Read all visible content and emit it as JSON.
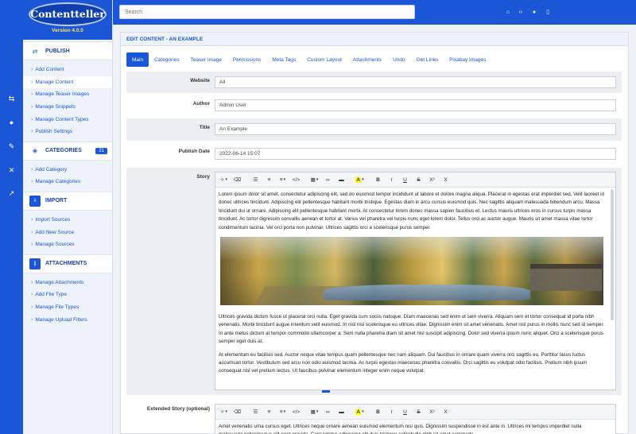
{
  "brand": {
    "logo_text": "Contentteller",
    "version": "Version 4.0.0"
  },
  "rail_icons": [
    "publish-icon",
    "user-icon",
    "edit-icon",
    "tools-icon",
    "external-link-icon"
  ],
  "sidebar": {
    "publish": {
      "title": "PUBLISH",
      "items": [
        "Add Content",
        "Manage Content",
        "Manage Teaser Images",
        "Manage Snippets",
        "Manage Content Types",
        "Publish Settings"
      ]
    },
    "categories": {
      "title": "CATEGORIES",
      "badge": "21",
      "items": [
        "Add Category",
        "Manage Categories"
      ]
    },
    "import": {
      "title": "IMPORT",
      "items": [
        "Import Sources",
        "Add New Source",
        "Manage Sources"
      ]
    },
    "attachments": {
      "title": "ATTACHMENTS",
      "items": [
        "Manage Attachments",
        "Add File Type",
        "Manage File Types",
        "Manage Upload Filters"
      ]
    }
  },
  "topbar": {
    "search_placeholder": "Search",
    "icons": [
      "home-icon",
      "code-icon",
      "user-icon",
      "window-icon"
    ]
  },
  "panel": {
    "title": "EDIT CONTENT - AN EXAMPLE",
    "tabs": [
      "Main",
      "Categories",
      "Teaser Image",
      "Permissions",
      "Meta Tags",
      "Custom Layout",
      "Attachments",
      "Undo",
      "Get Links",
      "Pixabay Images"
    ],
    "fields": {
      "website": {
        "label": "Website",
        "value": "All"
      },
      "author": {
        "label": "Author",
        "value": "Admin User"
      },
      "title": {
        "label": "Title",
        "value": "An Example"
      },
      "publish_date": {
        "label": "Publish Date",
        "value": "2022-06-14 15:07"
      }
    },
    "story": {
      "label": "Story",
      "para1": "Lorem ipsum dolor sit amet, consectetur adipiscing elit, sed do eiusmod tempor incididunt ut labore et dolore magna aliqua. Placerat in egestas erat imperdiet sed. Velit laoreet id donec ultrices tincidunt. Adipiscing elit pellentesque habitant morbi tristique. Egestas diam in arcu cursus euismod quis. Nec sagittis aliquam malesuada bibendum arcu. Massa tincidunt dui ut ornare. Adipiscing elit pellentesque habitant morbi. At consectetur lorem donec massa sapien faucibus et. Lectus mauris ultrices eros in cursus turpis massa tincidunt. Ac tortor dignissim convallis aenean et tortor at. Varius vel pharetra vel turpis nunc eget lorem dolor. Tellus orci ac auctor augue. Mauris sit amet massa vitae tortor condimentum lacinia. Vel orci porta non pulvinar. Ultrices sagittis orci a scelerisque purus semper.",
      "para2": "Ultrices gravida dictum fusce ut placerat orci nulla. Eget gravida cum sociis natoque. Diam maecenas sed enim ut sem viverra. Aliquam sem et tortor consequat id porta nibh venenatis. Morbi tincidunt augue interdum velit euismod. In nisl nisi scelerisque eu ultrices vitae. Dignissim enim sit amet venenatis. Amet nisl purus in mollis nunc sed id semper. In ante metus dictum at tempor commodo ullamcorper a. Sem nulla pharetra diam sit amet nisl suscipit adipiscing. Dolor sed viverra ipsum nunc aliquet. Orci a scelerisque purus semper eget duis at.",
      "para3": "At elementum eu facilisis sed. Auctor neque vitae tempus quam pellentesque nec nam aliquam. Dui faucibus in ornare quam viverra orci sagittis eu. Porttitor lacus luctus accumsan tortor. Vestibulum sed arcu non odio euismod lacinia. Ac turpis egestas maecenas pharetra convallis. Orci sagittis eu volutpat odio facilisis. Pretium nibh ipsum consequat nisl vel pretium lectus. Ut faucibus pulvinar elementum integer enim neque volutpat."
    },
    "extended_story": {
      "label": "Extended Story (optional)",
      "para1": "Amet venenatis urna cursus eget. Ultrices neque ornare aenean euismod elementum nisi quis. Dignissim suspendisse in est ante in. Ultrices mi tempus imperdiet nulla malesuada pellentesque elit eget gravida. Consectetur adipiscing elit duis tristique sollicitudin nibh sit amet commodo."
    },
    "editor_toolbar": {
      "font_a": "A",
      "bold": "B",
      "italic": "I",
      "underline": "U",
      "strike": "S",
      "sup": "X²",
      "clear": "X"
    }
  }
}
